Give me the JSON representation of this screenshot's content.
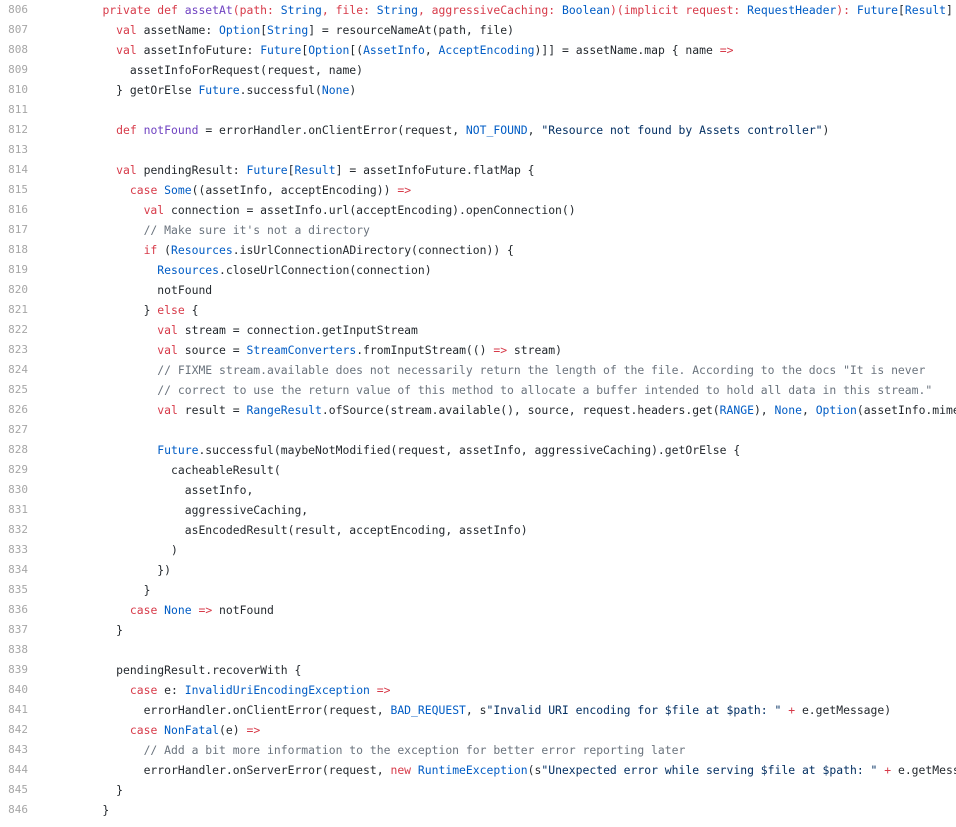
{
  "colors": {
    "keyword": "#d73a49",
    "type": "#005cc5",
    "string": "#032f62",
    "comment": "#6a737d",
    "plain": "#24292e",
    "line_number": "#a6a6a6",
    "background": "#ffffff"
  },
  "lines": [
    {
      "n": "806",
      "tokens": [
        [
          "    ",
          "pl"
        ],
        [
          "private def ",
          "kw"
        ],
        [
          "assetAt",
          "fn"
        ],
        [
          "(path: ",
          "kw"
        ],
        [
          "String",
          "ty"
        ],
        [
          ", file: ",
          "kw"
        ],
        [
          "String",
          "ty"
        ],
        [
          ", aggressiveCaching: ",
          "kw"
        ],
        [
          "Boolean",
          "ty"
        ],
        [
          ")(implicit request: ",
          "kw"
        ],
        [
          "RequestHeader",
          "ty"
        ],
        [
          "): ",
          "kw"
        ],
        [
          "Future",
          "ty"
        ],
        [
          "[",
          "pl"
        ],
        [
          "Result",
          "ty"
        ],
        [
          "] = {",
          "pl"
        ]
      ]
    },
    {
      "n": "807",
      "tokens": [
        [
          "      ",
          "pl"
        ],
        [
          "val ",
          "kw"
        ],
        [
          "assetName: ",
          "pl"
        ],
        [
          "Option",
          "ty"
        ],
        [
          "[",
          "pl"
        ],
        [
          "String",
          "ty"
        ],
        [
          "] = resourceNameAt(path, file)",
          "pl"
        ]
      ]
    },
    {
      "n": "808",
      "tokens": [
        [
          "      ",
          "pl"
        ],
        [
          "val ",
          "kw"
        ],
        [
          "assetInfoFuture: ",
          "pl"
        ],
        [
          "Future",
          "ty"
        ],
        [
          "[",
          "pl"
        ],
        [
          "Option",
          "ty"
        ],
        [
          "[(",
          "pl"
        ],
        [
          "AssetInfo",
          "ty"
        ],
        [
          ", ",
          "pl"
        ],
        [
          "AcceptEncoding",
          "ty"
        ],
        [
          ")]] = assetName.map { name ",
          "pl"
        ],
        [
          "=>",
          "kw"
        ]
      ]
    },
    {
      "n": "809",
      "tokens": [
        [
          "        assetInfoForRequest(request, name)",
          "pl"
        ]
      ]
    },
    {
      "n": "810",
      "tokens": [
        [
          "      } getOrElse ",
          "pl"
        ],
        [
          "Future",
          "ty"
        ],
        [
          ".successful(",
          "pl"
        ],
        [
          "None",
          "ty"
        ],
        [
          ")",
          "pl"
        ]
      ]
    },
    {
      "n": "811",
      "tokens": []
    },
    {
      "n": "812",
      "tokens": [
        [
          "      ",
          "pl"
        ],
        [
          "def ",
          "kw"
        ],
        [
          "notFound",
          "fn"
        ],
        [
          " = errorHandler.onClientError(request, ",
          "pl"
        ],
        [
          "NOT_FOUND",
          "ty"
        ],
        [
          ", ",
          "pl"
        ],
        [
          "\"Resource not found by Assets controller\"",
          "str"
        ],
        [
          ")",
          "pl"
        ]
      ]
    },
    {
      "n": "813",
      "tokens": []
    },
    {
      "n": "814",
      "tokens": [
        [
          "      ",
          "pl"
        ],
        [
          "val ",
          "kw"
        ],
        [
          "pendingResult: ",
          "pl"
        ],
        [
          "Future",
          "ty"
        ],
        [
          "[",
          "pl"
        ],
        [
          "Result",
          "ty"
        ],
        [
          "] = assetInfoFuture.flatMap {",
          "pl"
        ]
      ]
    },
    {
      "n": "815",
      "tokens": [
        [
          "        ",
          "pl"
        ],
        [
          "case ",
          "kw"
        ],
        [
          "Some",
          "ty"
        ],
        [
          "((assetInfo, acceptEncoding)) ",
          "pl"
        ],
        [
          "=>",
          "kw"
        ]
      ]
    },
    {
      "n": "816",
      "tokens": [
        [
          "          ",
          "pl"
        ],
        [
          "val ",
          "kw"
        ],
        [
          "connection = assetInfo.url(acceptEncoding).openConnection()",
          "pl"
        ]
      ]
    },
    {
      "n": "817",
      "tokens": [
        [
          "          ",
          "pl"
        ],
        [
          "// Make sure it's not a directory",
          "cm"
        ]
      ]
    },
    {
      "n": "818",
      "tokens": [
        [
          "          ",
          "pl"
        ],
        [
          "if ",
          "kw"
        ],
        [
          "(",
          "pl"
        ],
        [
          "Resources",
          "ty"
        ],
        [
          ".isUrlConnectionADirectory(connection)) {",
          "pl"
        ]
      ]
    },
    {
      "n": "819",
      "tokens": [
        [
          "            ",
          "pl"
        ],
        [
          "Resources",
          "ty"
        ],
        [
          ".closeUrlConnection(connection)",
          "pl"
        ]
      ]
    },
    {
      "n": "820",
      "tokens": [
        [
          "            notFound",
          "pl"
        ]
      ]
    },
    {
      "n": "821",
      "tokens": [
        [
          "          } ",
          "pl"
        ],
        [
          "else ",
          "kw"
        ],
        [
          "{",
          "pl"
        ]
      ]
    },
    {
      "n": "822",
      "tokens": [
        [
          "            ",
          "pl"
        ],
        [
          "val ",
          "kw"
        ],
        [
          "stream = connection.getInputStream",
          "pl"
        ]
      ]
    },
    {
      "n": "823",
      "tokens": [
        [
          "            ",
          "pl"
        ],
        [
          "val ",
          "kw"
        ],
        [
          "source = ",
          "pl"
        ],
        [
          "StreamConverters",
          "ty"
        ],
        [
          ".fromInputStream(() ",
          "pl"
        ],
        [
          "=>",
          "kw"
        ],
        [
          " stream)",
          "pl"
        ]
      ]
    },
    {
      "n": "824",
      "tokens": [
        [
          "            ",
          "pl"
        ],
        [
          "// FIXME stream.available does not necessarily return the length of the file. According to the docs \"It is never",
          "cm"
        ]
      ]
    },
    {
      "n": "825",
      "tokens": [
        [
          "            ",
          "pl"
        ],
        [
          "// correct to use the return value of this method to allocate a buffer intended to hold all data in this stream.\"",
          "cm"
        ]
      ]
    },
    {
      "n": "826",
      "tokens": [
        [
          "            ",
          "pl"
        ],
        [
          "val ",
          "kw"
        ],
        [
          "result = ",
          "pl"
        ],
        [
          "RangeResult",
          "ty"
        ],
        [
          ".ofSource(stream.available(), source, request.headers.get(",
          "pl"
        ],
        [
          "RANGE",
          "ty"
        ],
        [
          "), ",
          "pl"
        ],
        [
          "None",
          "ty"
        ],
        [
          ", ",
          "pl"
        ],
        [
          "Option",
          "ty"
        ],
        [
          "(assetInfo.mimeType))",
          "pl"
        ]
      ]
    },
    {
      "n": "827",
      "tokens": []
    },
    {
      "n": "828",
      "tokens": [
        [
          "            ",
          "pl"
        ],
        [
          "Future",
          "ty"
        ],
        [
          ".successful(maybeNotModified(request, assetInfo, aggressiveCaching).getOrElse {",
          "pl"
        ]
      ]
    },
    {
      "n": "829",
      "tokens": [
        [
          "              cacheableResult(",
          "pl"
        ]
      ]
    },
    {
      "n": "830",
      "tokens": [
        [
          "                assetInfo,",
          "pl"
        ]
      ]
    },
    {
      "n": "831",
      "tokens": [
        [
          "                aggressiveCaching,",
          "pl"
        ]
      ]
    },
    {
      "n": "832",
      "tokens": [
        [
          "                asEncodedResult(result, acceptEncoding, assetInfo)",
          "pl"
        ]
      ]
    },
    {
      "n": "833",
      "tokens": [
        [
          "              )",
          "pl"
        ]
      ]
    },
    {
      "n": "834",
      "tokens": [
        [
          "            })",
          "pl"
        ]
      ]
    },
    {
      "n": "835",
      "tokens": [
        [
          "          }",
          "pl"
        ]
      ]
    },
    {
      "n": "836",
      "tokens": [
        [
          "        ",
          "pl"
        ],
        [
          "case ",
          "kw"
        ],
        [
          "None",
          "ty"
        ],
        [
          " ",
          "pl"
        ],
        [
          "=>",
          "kw"
        ],
        [
          " notFound",
          "pl"
        ]
      ]
    },
    {
      "n": "837",
      "tokens": [
        [
          "      }",
          "pl"
        ]
      ]
    },
    {
      "n": "838",
      "tokens": []
    },
    {
      "n": "839",
      "tokens": [
        [
          "      pendingResult.recoverWith {",
          "pl"
        ]
      ]
    },
    {
      "n": "840",
      "tokens": [
        [
          "        ",
          "pl"
        ],
        [
          "case ",
          "kw"
        ],
        [
          "e: ",
          "pl"
        ],
        [
          "InvalidUriEncodingException",
          "ty"
        ],
        [
          " ",
          "pl"
        ],
        [
          "=>",
          "kw"
        ]
      ]
    },
    {
      "n": "841",
      "tokens": [
        [
          "          errorHandler.onClientError(request, ",
          "pl"
        ],
        [
          "BAD_REQUEST",
          "ty"
        ],
        [
          ", s",
          "pl"
        ],
        [
          "\"Invalid URI encoding for $file at $path: \"",
          "str"
        ],
        [
          " ",
          "pl"
        ],
        [
          "+",
          "kw"
        ],
        [
          " e.getMessage)",
          "pl"
        ]
      ]
    },
    {
      "n": "842",
      "tokens": [
        [
          "        ",
          "pl"
        ],
        [
          "case ",
          "kw"
        ],
        [
          "NonFatal",
          "ty"
        ],
        [
          "(e) ",
          "pl"
        ],
        [
          "=>",
          "kw"
        ]
      ]
    },
    {
      "n": "843",
      "tokens": [
        [
          "          ",
          "pl"
        ],
        [
          "// Add a bit more information to the exception for better error reporting later",
          "cm"
        ]
      ]
    },
    {
      "n": "844",
      "tokens": [
        [
          "          errorHandler.onServerError(request, ",
          "pl"
        ],
        [
          "new ",
          "kw"
        ],
        [
          "RuntimeException",
          "ty"
        ],
        [
          "(s",
          "pl"
        ],
        [
          "\"Unexpected error while serving $file at $path: \"",
          "str"
        ],
        [
          " ",
          "pl"
        ],
        [
          "+",
          "kw"
        ],
        [
          " e.getMessage, e))",
          "pl"
        ]
      ]
    },
    {
      "n": "845",
      "tokens": [
        [
          "      }",
          "pl"
        ]
      ]
    },
    {
      "n": "846",
      "tokens": [
        [
          "    }",
          "pl"
        ]
      ]
    }
  ]
}
